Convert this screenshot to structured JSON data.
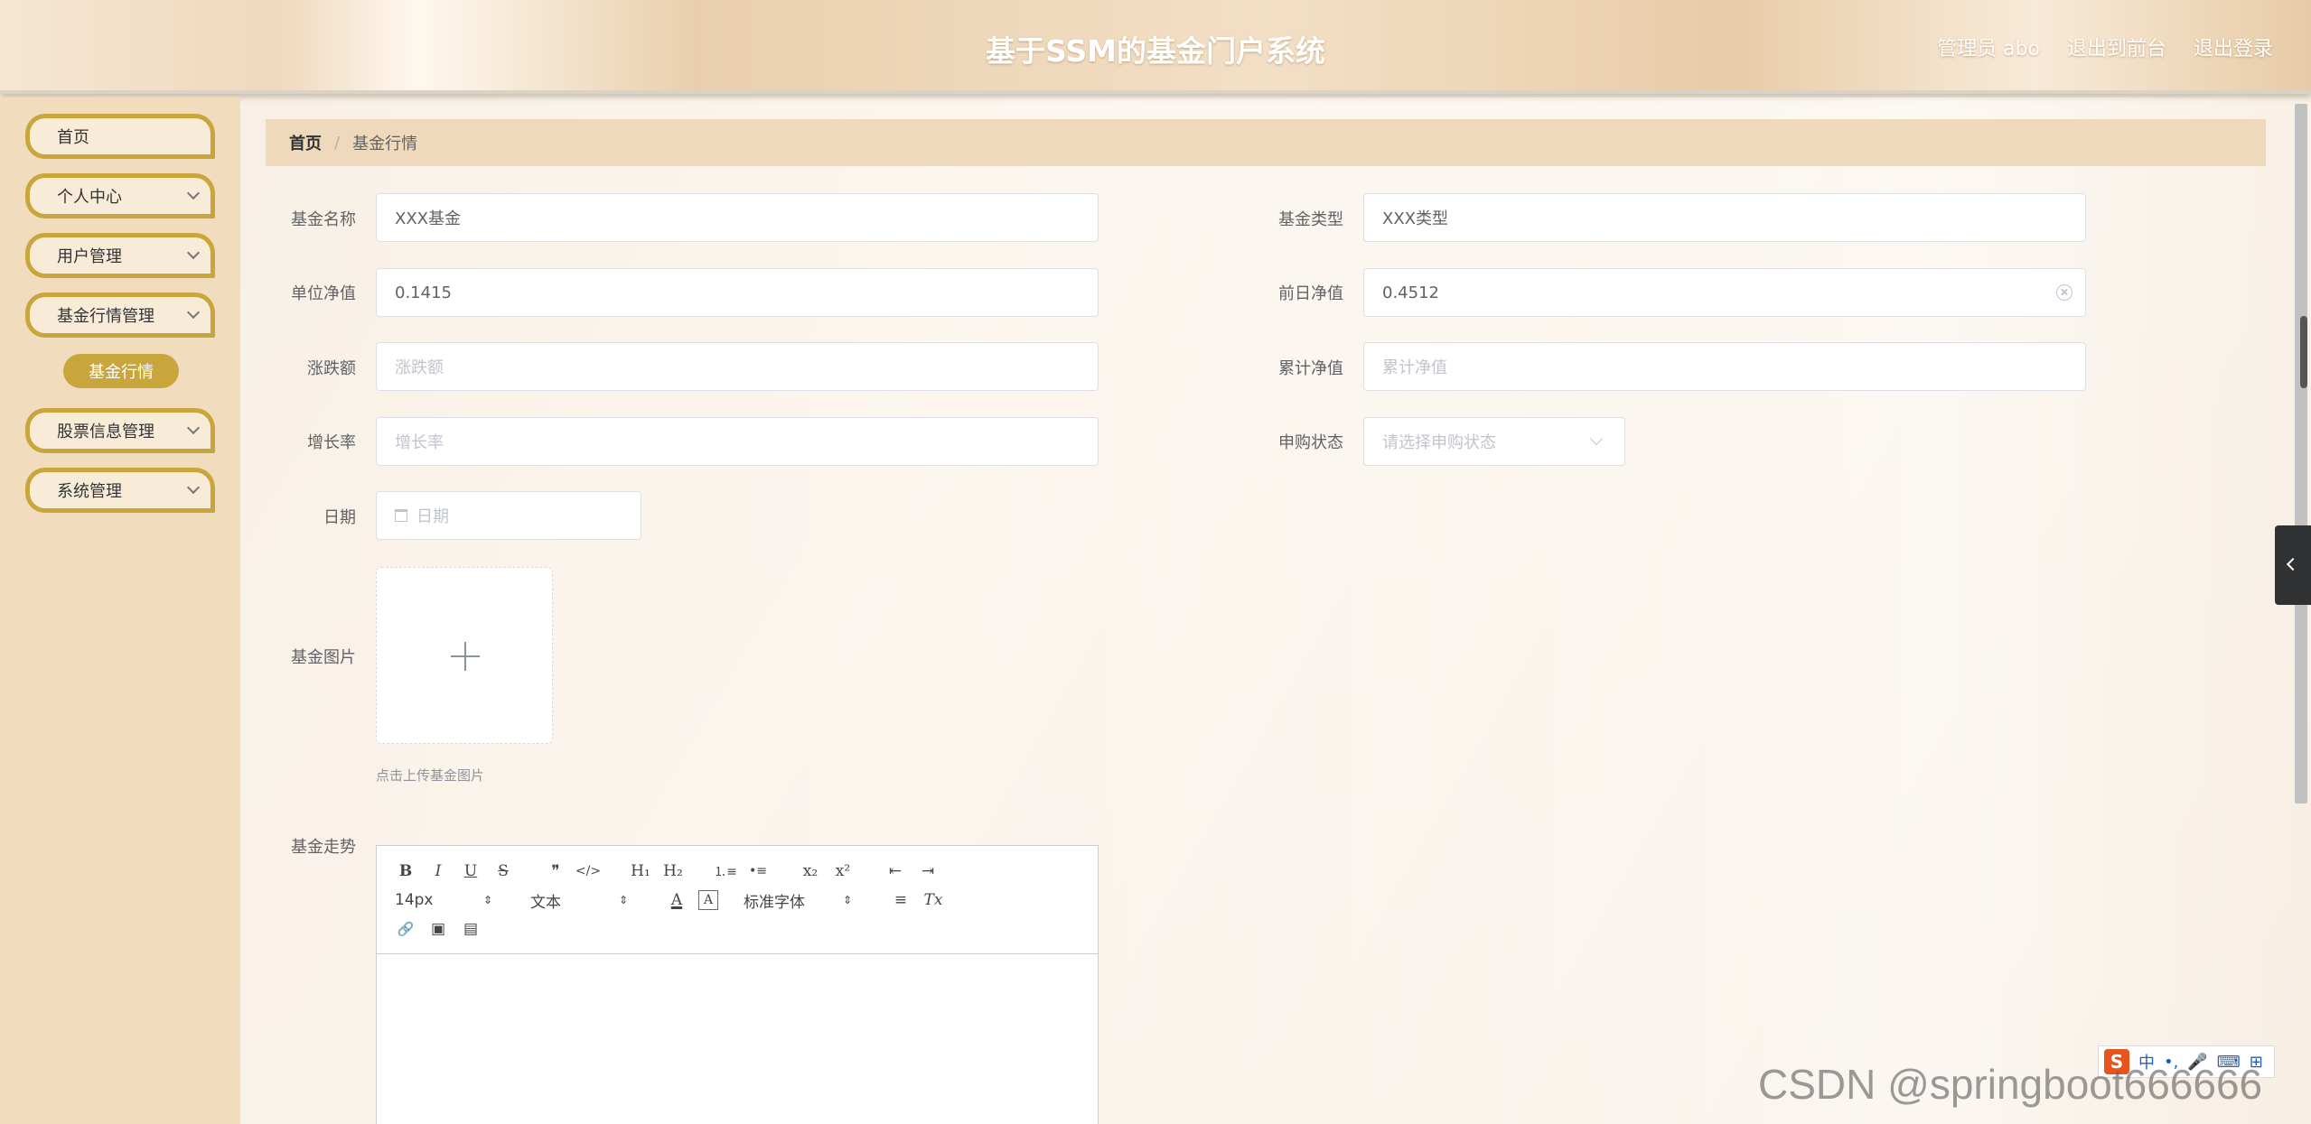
{
  "header": {
    "title": "基于SSM的基金门户系统",
    "admin_label": "管理员 abo",
    "back_frontend": "退出到前台",
    "logout": "退出登录"
  },
  "sidebar": {
    "items": [
      {
        "label": "首页"
      },
      {
        "label": "个人中心"
      },
      {
        "label": "用户管理"
      },
      {
        "label": "基金行情管理"
      },
      {
        "label": "股票信息管理"
      },
      {
        "label": "系统管理"
      }
    ],
    "active_sub": "基金行情"
  },
  "breadcrumb": {
    "home": "首页",
    "sep": "/",
    "current": "基金行情"
  },
  "form": {
    "fund_name": {
      "label": "基金名称",
      "value": "XXX基金"
    },
    "fund_type": {
      "label": "基金类型",
      "value": "XXX类型"
    },
    "unit_nav": {
      "label": "单位净值",
      "value": "0.1415"
    },
    "prev_nav": {
      "label": "前日净值",
      "value": "0.4512"
    },
    "change": {
      "label": "涨跌额",
      "placeholder": "涨跌额"
    },
    "cum_nav": {
      "label": "累计净值",
      "placeholder": "累计净值"
    },
    "growth": {
      "label": "增长率",
      "placeholder": "增长率"
    },
    "purchase_status": {
      "label": "申购状态",
      "placeholder": "请选择申购状态"
    },
    "date": {
      "label": "日期",
      "placeholder": "日期"
    },
    "image": {
      "label": "基金图片",
      "tip": "点击上传基金图片"
    },
    "trend": {
      "label": "基金走势"
    }
  },
  "editor": {
    "bold": "B",
    "italic": "I",
    "underline": "U",
    "strike": "S",
    "quote": "❞",
    "code": "</>",
    "h1": "H₁",
    "h2": "H₂",
    "ol": "⒈≡",
    "ul": "•≡",
    "sub": "x₂",
    "sup": "x²",
    "outdent": "⇤",
    "indent": "⇥",
    "size": "14px",
    "para": "文本",
    "color": "A",
    "bg": "A",
    "font": "标准字体",
    "align": "≡",
    "clear": "Tx",
    "link": "🔗",
    "image": "▣",
    "video": "▤"
  },
  "ime": {
    "s": "S",
    "zh": "中",
    "dot": "•,",
    "mic": "🎤",
    "kb": "⌨",
    "grid": "⊞"
  },
  "watermark": "CSDN @springboot666666"
}
